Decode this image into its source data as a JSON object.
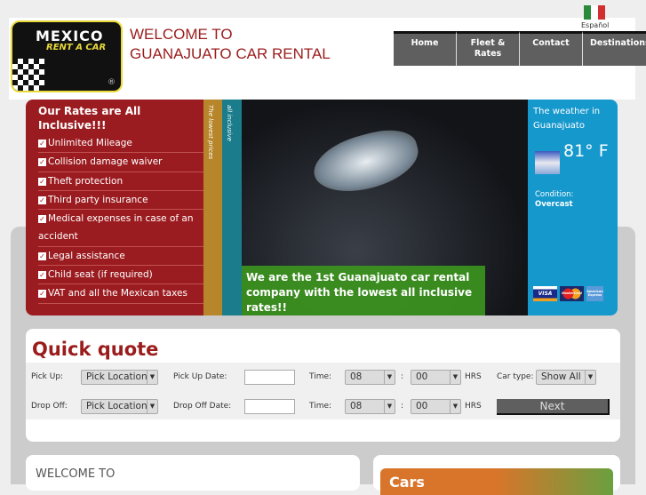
{
  "header": {
    "logo_text": "MEXICO RENT A CAR",
    "title_line1": "WELCOME TO",
    "title_line2": "GUANAJUATO CAR RENTAL",
    "language": "Español"
  },
  "nav": [
    {
      "label": "Home"
    },
    {
      "label": "Fleet & Rates"
    },
    {
      "label": "Contact"
    },
    {
      "label": "Destinations"
    }
  ],
  "rates": {
    "title": "Our Rates are All Inclusive!!!",
    "items": [
      "Unlimited Mileage",
      "Collision damage waiver",
      "Theft protection",
      "Third party insurance",
      "Medical expenses in case of an accident",
      "Legal assistance",
      "Child seat (if required)",
      "VAT and all the Mexican taxes"
    ]
  },
  "strips": {
    "gold": "The lowest prices",
    "teal": "all inclusive"
  },
  "hero": {
    "banner": "We are the 1st Guanajuato car rental company with the lowest all inclusive rates!!"
  },
  "weather": {
    "title": "The weather in Guanajuato",
    "temp": "81° F",
    "condition_label": "Condition:",
    "condition": "Overcast",
    "cards": [
      "VISA",
      "MasterCard",
      "American Express"
    ]
  },
  "quote": {
    "title": "Quick quote",
    "pickup_label": "Pick Up:",
    "pickup_value": "Pick Location",
    "pickup_date_label": "Pick Up Date:",
    "pickup_date": "",
    "time_label": "Time:",
    "hour": "08",
    "minute": "00",
    "colon": ":",
    "hrs": "HRS",
    "car_type_label": "Car type:",
    "car_type": "Show All",
    "dropoff_label": "Drop Off:",
    "dropoff_value": "Pick Location",
    "dropoff_date_label": "Drop Off Date:",
    "dropoff_date": "",
    "next": "Next"
  },
  "welcome": {
    "title": "WELCOME TO"
  },
  "cars": {
    "title": "Cars"
  }
}
